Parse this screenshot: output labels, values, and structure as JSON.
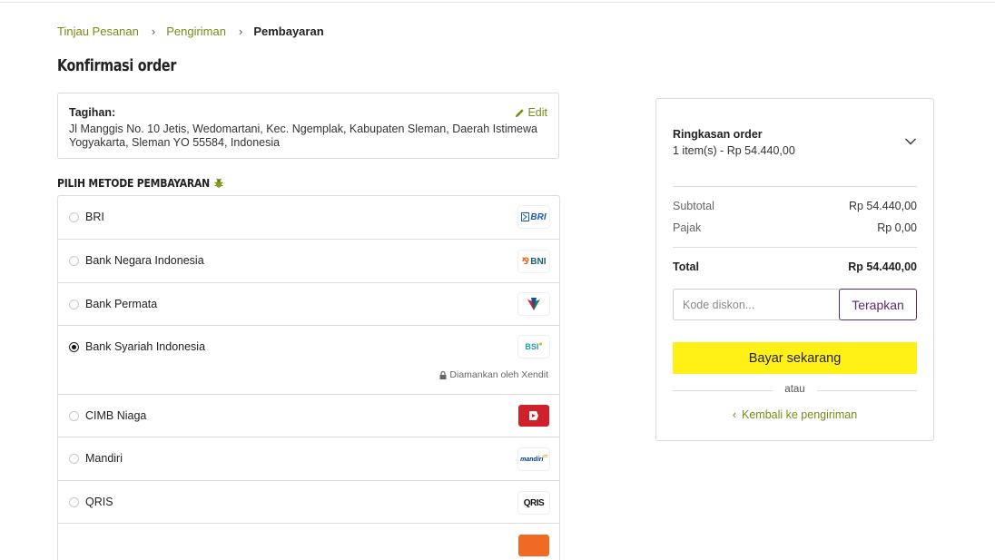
{
  "breadcrumb": {
    "items": [
      "Tinjau Pesanan",
      "Pengiriman"
    ],
    "current": "Pembayaran"
  },
  "page_title": "Konfirmasi order",
  "billing": {
    "label": "Tagihan:",
    "address": "Jl Manggis No. 10 Jetis, Wedomartani, Kec. Ngemplak, Kabupaten Sleman, Daerah Istimewa Yogyakarta, Sleman YO 55584, Indonesia",
    "edit_label": "Edit"
  },
  "payment": {
    "heading": "PILIH METODE PEMBAYARAN",
    "heading_icon": "bug-icon",
    "secured_text": "Diamankan oleh Xendit",
    "methods": [
      {
        "label": "BRI",
        "logo": "BRI",
        "selected": false
      },
      {
        "label": "Bank Negara Indonesia",
        "logo": "BNI",
        "selected": false
      },
      {
        "label": "Bank Permata",
        "logo": "permata-logo",
        "selected": false
      },
      {
        "label": "Bank Syariah Indonesia",
        "logo": "BSI",
        "selected": true
      },
      {
        "label": "CIMB Niaga",
        "logo": "cimb-logo",
        "selected": false
      },
      {
        "label": "Mandiri",
        "logo": "mandiri",
        "selected": false
      },
      {
        "label": "QRIS",
        "logo": "QRIS",
        "selected": false
      }
    ]
  },
  "summary": {
    "title": "Ringkasan order",
    "items": "1 item(s) -  Rp 54.440,00",
    "subtotal_label": "Subtotal",
    "subtotal_value": "Rp 54.440,00",
    "tax_label": "Pajak",
    "tax_value": "Rp 0,00",
    "total_label": "Total",
    "total_value": "Rp 54.440,00",
    "discount_placeholder": "Kode diskon...",
    "apply_label": "Terapkan",
    "pay_label": "Bayar sekarang",
    "or_text": "atau",
    "back_label": "Kembali ke pengiriman"
  },
  "colors": {
    "accent_link": "#7a8a16",
    "pay_button": "#fff116",
    "apply_border": "#5a2a6e"
  }
}
